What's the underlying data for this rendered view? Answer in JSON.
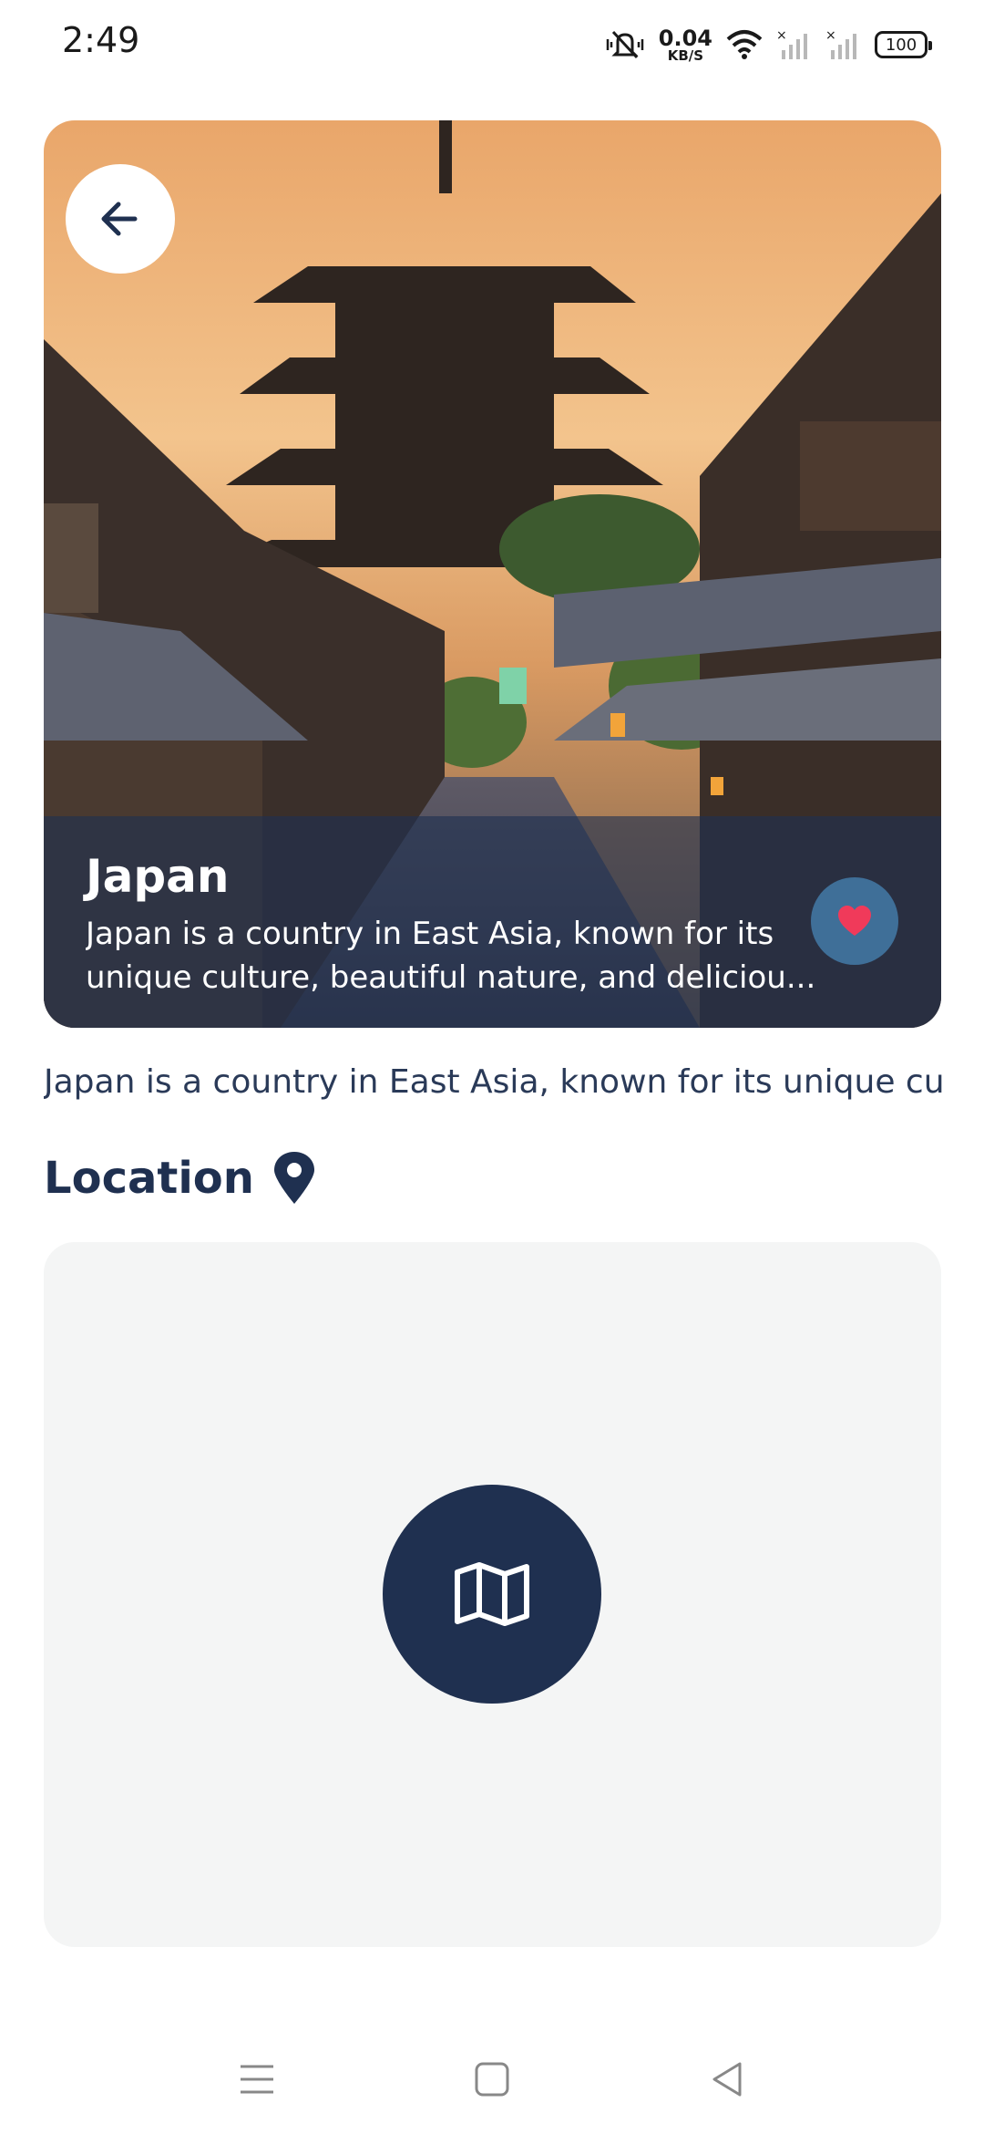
{
  "status_bar": {
    "time": "2:49",
    "net_speed_value": "0.04",
    "net_speed_unit": "KB/S",
    "battery": "100",
    "icons": [
      "mute-vibrate-icon",
      "wifi-icon",
      "signal-no-service-icon",
      "signal-no-service-icon",
      "battery-icon"
    ]
  },
  "destination": {
    "title": "Japan",
    "description_line1": "Japan is a country in East Asia, known for its",
    "description_line2": "unique culture, beautiful nature, and deliciou...",
    "summary": "Japan is a country in East Asia, known for its unique cultu..."
  },
  "location": {
    "heading": "Location"
  },
  "colors": {
    "primary": "#1f3050",
    "favorite_bg": "#3f6f98",
    "heart": "#f03a5a",
    "map_bg": "#f4f5f5"
  },
  "icons": {
    "back": "arrow-left-icon",
    "favorite": "heart-icon",
    "location": "map-pin-icon",
    "map": "folded-map-icon"
  }
}
